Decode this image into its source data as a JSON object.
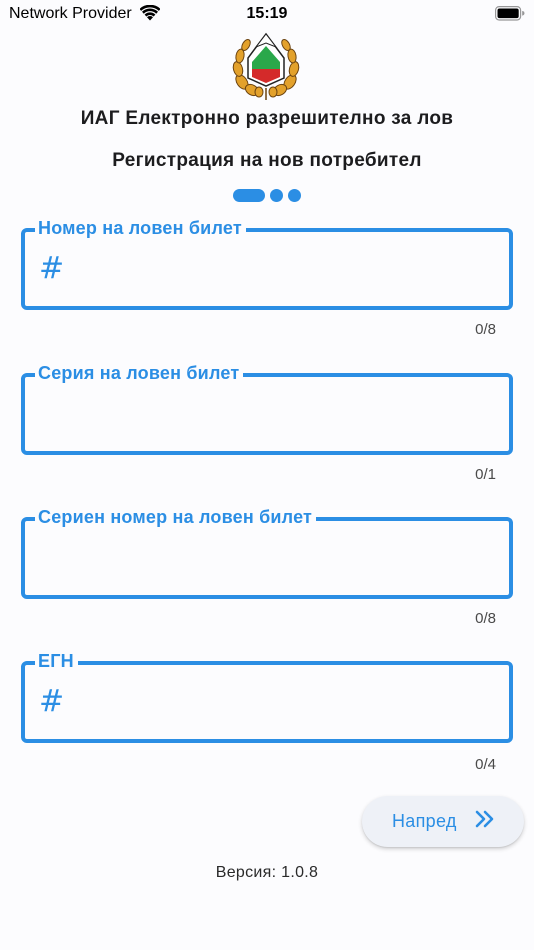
{
  "status_bar": {
    "carrier": "Network Provider",
    "time": "15:19"
  },
  "header": {
    "title": "ИАГ Електронно разрешително за лов",
    "subtitle": "Регистрация на нов потребител"
  },
  "stepper": {
    "total_steps": 3,
    "current_step": 1
  },
  "fields": [
    {
      "label": "Номер на ловен билет",
      "value": "",
      "counter": "0/8",
      "icon": "hash-icon"
    },
    {
      "label": "Серия на ловен билет",
      "value": "",
      "counter": "0/1"
    },
    {
      "label": "Сериен номер на ловен билет",
      "value": "",
      "counter": "0/8"
    },
    {
      "label": "ЕГН",
      "value": "",
      "counter": "0/4",
      "icon": "hash-icon"
    }
  ],
  "actions": {
    "next_label": "Напред",
    "next_icon": "double-chevron-right-icon"
  },
  "footer": {
    "version": "Версия: 1.0.8"
  },
  "colors": {
    "accent": "#2b8ee4",
    "background": "#fcfcfe",
    "button_bg": "#eef1f7"
  }
}
